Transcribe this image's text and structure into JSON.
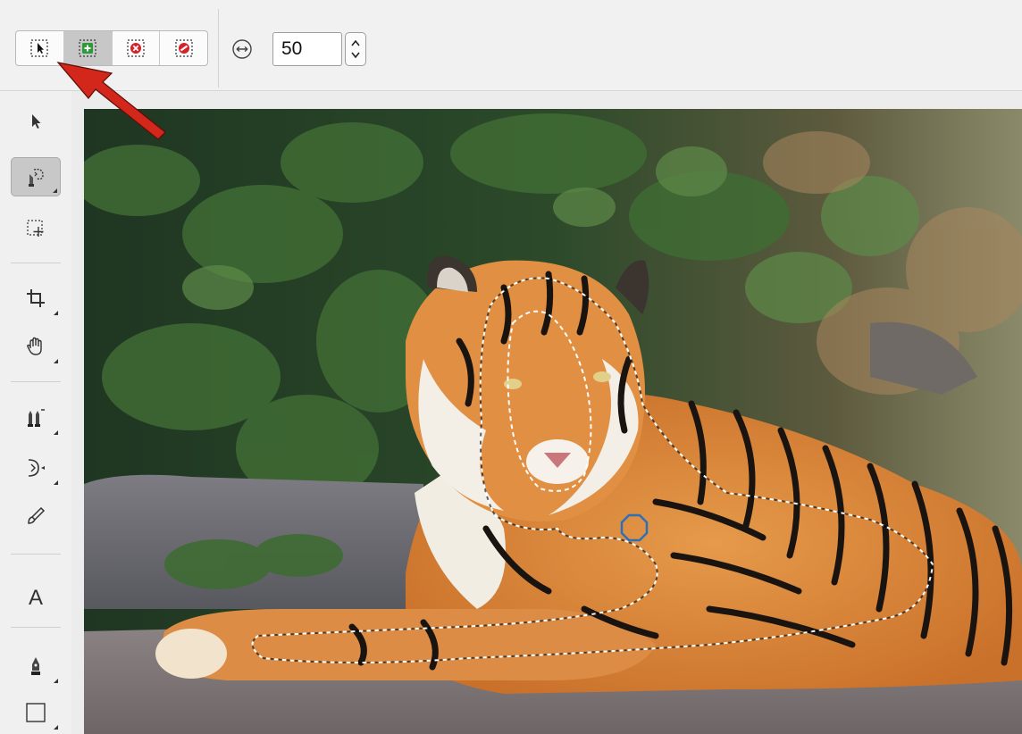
{
  "toolbar": {
    "selection_modes": [
      {
        "name": "new-selection",
        "active": false
      },
      {
        "name": "add-to-selection",
        "active": true
      },
      {
        "name": "subtract-from-selection",
        "active": false
      },
      {
        "name": "intersect-selection",
        "active": false
      }
    ],
    "brush_width_icon": "width-arrows-icon",
    "brush_width_value": "50"
  },
  "toolbox": {
    "tools": [
      {
        "icon": "move-arrow-icon"
      },
      {
        "icon": "selection-brush-icon",
        "active": true
      },
      {
        "icon": "marquee-selection-icon"
      },
      {
        "icon": "crop-icon"
      },
      {
        "icon": "hand-pan-icon"
      },
      {
        "icon": "clone-stamp-icon"
      },
      {
        "icon": "pen-node-icon"
      },
      {
        "icon": "paint-brush-icon"
      },
      {
        "text": "A"
      },
      {
        "icon": "pen-tool-icon"
      },
      {
        "icon": "rectangle-shape-icon"
      }
    ]
  },
  "colors": {
    "accent_active": "#c7c7c7",
    "annotation_arrow": "#d2271a",
    "marching_ants": "#ffffff",
    "brush_cursor": "#2f6fb8"
  }
}
